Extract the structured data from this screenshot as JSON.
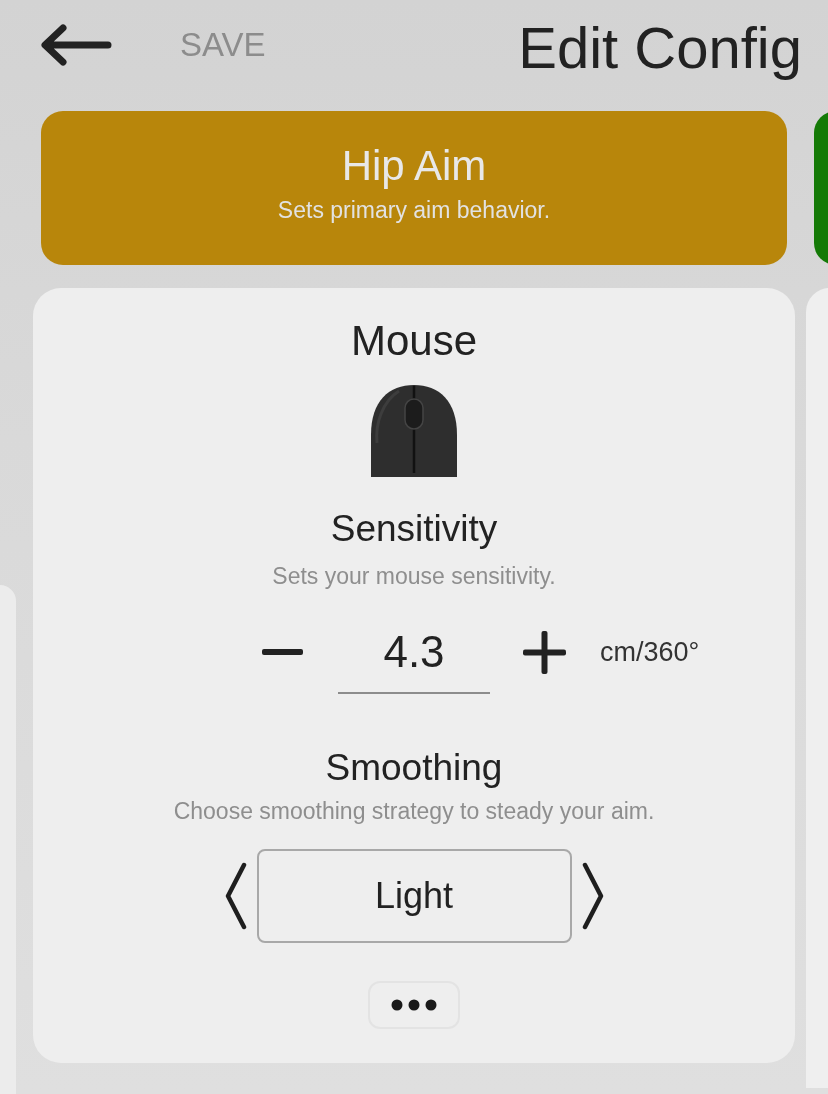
{
  "header": {
    "save": {
      "label": "SAVE",
      "disabled": true
    },
    "title": "Edit Config"
  },
  "mode_cards": [
    {
      "title": "Hip Aim",
      "description": "Sets primary aim behavior.",
      "color": "#b8860b"
    },
    {
      "color": "#147a06"
    }
  ],
  "panel": {
    "title": "Mouse",
    "settings": [
      {
        "kind": "stepper",
        "title": "Sensitivity",
        "description": "Sets your mouse sensitivity.",
        "value": "4.3",
        "unit": "cm/360°"
      },
      {
        "kind": "selector",
        "title": "Smoothing",
        "description": "Choose smoothing strategy to steady your aim.",
        "value": "Light"
      }
    ]
  }
}
